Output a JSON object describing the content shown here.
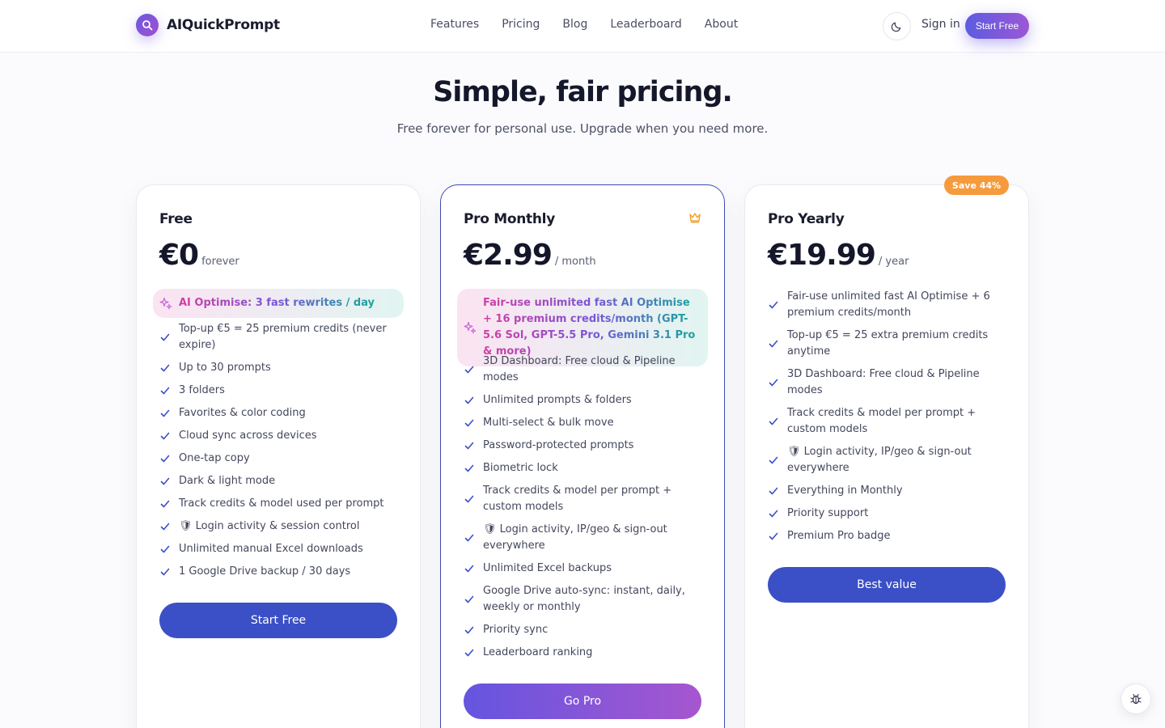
{
  "brand": {
    "name": "AIQuickPrompt"
  },
  "nav": [
    "Features",
    "Pricing",
    "Blog",
    "Leaderboard",
    "About"
  ],
  "header": {
    "signin": "Sign in",
    "start_free": "Start Free"
  },
  "hero": {
    "title": "Simple, fair pricing.",
    "subtitle": "Free forever for personal use. Upgrade when you need more."
  },
  "plans": [
    {
      "name": "Free",
      "price": "€0",
      "period": "forever",
      "highlight": "AI Optimise: 3 fast rewrites / day",
      "features": [
        "Top-up €5 = 25 premium credits (never expire)",
        "Up to 30 prompts",
        "3 folders",
        "Favorites & color coding",
        "Cloud sync across devices",
        "One-tap copy",
        "Dark & light mode",
        "Track credits & model used per prompt",
        "🛡 Login activity & session control",
        "Unlimited manual Excel downloads",
        "1 Google Drive backup / 30 days"
      ],
      "cta": "Start Free"
    },
    {
      "name": "Pro Monthly",
      "price": "€2.99",
      "period": "/ month",
      "highlight": "Fair-use unlimited fast AI Optimise + 16 premium credits/month (GPT-5.6 Sol, GPT-5.5 Pro, Gemini 3.1 Pro & more)",
      "features": [
        "3D Dashboard: Free cloud & Pipeline modes",
        "Unlimited prompts & folders",
        "Multi-select & bulk move",
        "Password-protected prompts",
        "Biometric lock",
        "Track credits & model per prompt + custom models",
        "🛡 Login activity, IP/geo & sign-out everywhere",
        "Unlimited Excel backups",
        "Google Drive auto-sync: instant, daily, weekly or monthly",
        "Priority sync",
        "Leaderboard ranking"
      ],
      "cta": "Go Pro"
    },
    {
      "name": "Pro Yearly",
      "price": "€19.99",
      "period": "/ year",
      "badge": "Save 44%",
      "features": [
        "Fair-use unlimited fast AI Optimise + 6 premium credits/month",
        "Top-up €5 = 25 extra premium credits anytime",
        "3D Dashboard: Free cloud & Pipeline modes",
        "Track credits & model per prompt + custom models",
        "🛡 Login activity, IP/geo & sign-out everywhere",
        "Everything in Monthly",
        "Priority support",
        "Premium Pro badge"
      ],
      "cta": "Best value"
    }
  ],
  "colors": {
    "accent_blue": "#3b4fc6",
    "accent_purple": "#7a55d8",
    "badge_orange": "#f59b3d",
    "check": "#3b4fc6"
  },
  "icons": {
    "logo": "search-icon",
    "theme": "moon-icon",
    "check": "check-icon",
    "sparkle": "sparkle-icon",
    "crown": "crown-icon",
    "debug": "bug-icon"
  }
}
